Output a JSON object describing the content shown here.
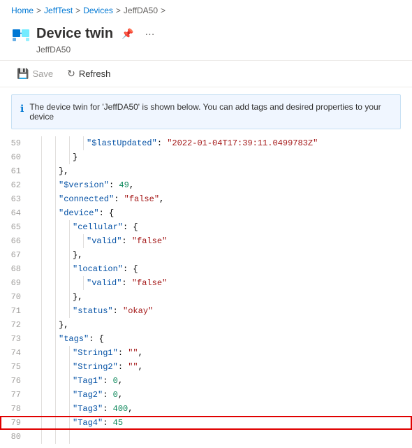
{
  "breadcrumb": {
    "items": [
      "Home",
      "JeffTest",
      "Devices",
      "JeffDA50"
    ],
    "separators": [
      ">",
      ">",
      ">"
    ]
  },
  "header": {
    "title": "Device twin",
    "subtitle": "JeffDA50",
    "pin_label": "📌",
    "more_label": "···"
  },
  "toolbar": {
    "save_label": "Save",
    "refresh_label": "Refresh"
  },
  "info_banner": {
    "text": "The device twin for 'JeffDA50' is shown below. You can add tags and desired properties to your device"
  },
  "code": {
    "lines": [
      {
        "num": 59,
        "indent": 4,
        "content": "\"$lastUpdated\": \"2022-01-04T17:39:11.0499783Z\""
      },
      {
        "num": 60,
        "indent": 3,
        "content": "}"
      },
      {
        "num": 61,
        "indent": 2,
        "content": "},"
      },
      {
        "num": 62,
        "indent": 2,
        "content": "\"$version\": 49,"
      },
      {
        "num": 63,
        "indent": 2,
        "content": "\"connected\": \"false\","
      },
      {
        "num": 64,
        "indent": 2,
        "content": "\"device\": {"
      },
      {
        "num": 65,
        "indent": 3,
        "content": "\"cellular\": {"
      },
      {
        "num": 66,
        "indent": 4,
        "content": "\"valid\": \"false\""
      },
      {
        "num": 67,
        "indent": 3,
        "content": "},"
      },
      {
        "num": 68,
        "indent": 3,
        "content": "\"location\": {"
      },
      {
        "num": 69,
        "indent": 4,
        "content": "\"valid\": \"false\""
      },
      {
        "num": 70,
        "indent": 3,
        "content": "},"
      },
      {
        "num": 71,
        "indent": 3,
        "content": "\"status\": \"okay\""
      },
      {
        "num": 72,
        "indent": 2,
        "content": "},"
      },
      {
        "num": 73,
        "indent": 2,
        "content": "\"tags\": {"
      },
      {
        "num": 74,
        "indent": 3,
        "content": "\"String1\": \"\","
      },
      {
        "num": 75,
        "indent": 3,
        "content": "\"String2\": \"\","
      },
      {
        "num": 76,
        "indent": 3,
        "content": "\"Tag1\": 0,"
      },
      {
        "num": 77,
        "indent": 3,
        "content": "\"Tag2\": 0,"
      },
      {
        "num": 78,
        "indent": 3,
        "content": "\"Tag3\": 400,"
      },
      {
        "num": 79,
        "indent": 3,
        "content": "\"Tag4\": 45",
        "highlighted": true
      },
      {
        "num": 80,
        "indent": 3,
        "content": ""
      }
    ]
  }
}
